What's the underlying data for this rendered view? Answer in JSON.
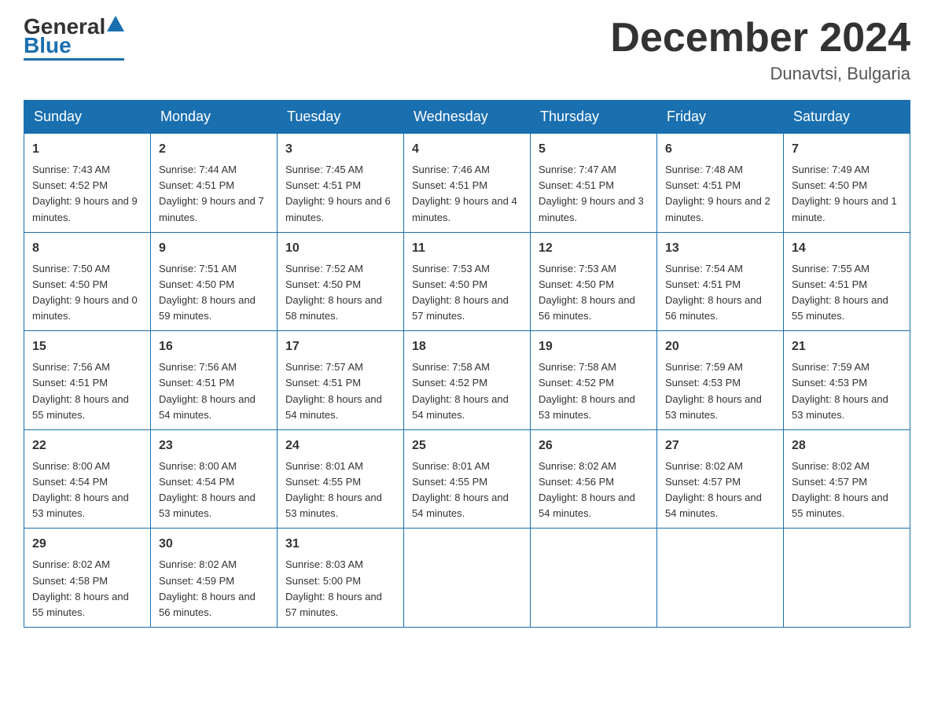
{
  "logo": {
    "general": "General",
    "blue": "Blue"
  },
  "header": {
    "title": "December 2024",
    "location": "Dunavtsi, Bulgaria"
  },
  "days_of_week": [
    "Sunday",
    "Monday",
    "Tuesday",
    "Wednesday",
    "Thursday",
    "Friday",
    "Saturday"
  ],
  "weeks": [
    [
      {
        "day": "1",
        "sunrise": "7:43 AM",
        "sunset": "4:52 PM",
        "daylight": "9 hours and 9 minutes."
      },
      {
        "day": "2",
        "sunrise": "7:44 AM",
        "sunset": "4:51 PM",
        "daylight": "9 hours and 7 minutes."
      },
      {
        "day": "3",
        "sunrise": "7:45 AM",
        "sunset": "4:51 PM",
        "daylight": "9 hours and 6 minutes."
      },
      {
        "day": "4",
        "sunrise": "7:46 AM",
        "sunset": "4:51 PM",
        "daylight": "9 hours and 4 minutes."
      },
      {
        "day": "5",
        "sunrise": "7:47 AM",
        "sunset": "4:51 PM",
        "daylight": "9 hours and 3 minutes."
      },
      {
        "day": "6",
        "sunrise": "7:48 AM",
        "sunset": "4:51 PM",
        "daylight": "9 hours and 2 minutes."
      },
      {
        "day": "7",
        "sunrise": "7:49 AM",
        "sunset": "4:50 PM",
        "daylight": "9 hours and 1 minute."
      }
    ],
    [
      {
        "day": "8",
        "sunrise": "7:50 AM",
        "sunset": "4:50 PM",
        "daylight": "9 hours and 0 minutes."
      },
      {
        "day": "9",
        "sunrise": "7:51 AM",
        "sunset": "4:50 PM",
        "daylight": "8 hours and 59 minutes."
      },
      {
        "day": "10",
        "sunrise": "7:52 AM",
        "sunset": "4:50 PM",
        "daylight": "8 hours and 58 minutes."
      },
      {
        "day": "11",
        "sunrise": "7:53 AM",
        "sunset": "4:50 PM",
        "daylight": "8 hours and 57 minutes."
      },
      {
        "day": "12",
        "sunrise": "7:53 AM",
        "sunset": "4:50 PM",
        "daylight": "8 hours and 56 minutes."
      },
      {
        "day": "13",
        "sunrise": "7:54 AM",
        "sunset": "4:51 PM",
        "daylight": "8 hours and 56 minutes."
      },
      {
        "day": "14",
        "sunrise": "7:55 AM",
        "sunset": "4:51 PM",
        "daylight": "8 hours and 55 minutes."
      }
    ],
    [
      {
        "day": "15",
        "sunrise": "7:56 AM",
        "sunset": "4:51 PM",
        "daylight": "8 hours and 55 minutes."
      },
      {
        "day": "16",
        "sunrise": "7:56 AM",
        "sunset": "4:51 PM",
        "daylight": "8 hours and 54 minutes."
      },
      {
        "day": "17",
        "sunrise": "7:57 AM",
        "sunset": "4:51 PM",
        "daylight": "8 hours and 54 minutes."
      },
      {
        "day": "18",
        "sunrise": "7:58 AM",
        "sunset": "4:52 PM",
        "daylight": "8 hours and 54 minutes."
      },
      {
        "day": "19",
        "sunrise": "7:58 AM",
        "sunset": "4:52 PM",
        "daylight": "8 hours and 53 minutes."
      },
      {
        "day": "20",
        "sunrise": "7:59 AM",
        "sunset": "4:53 PM",
        "daylight": "8 hours and 53 minutes."
      },
      {
        "day": "21",
        "sunrise": "7:59 AM",
        "sunset": "4:53 PM",
        "daylight": "8 hours and 53 minutes."
      }
    ],
    [
      {
        "day": "22",
        "sunrise": "8:00 AM",
        "sunset": "4:54 PM",
        "daylight": "8 hours and 53 minutes."
      },
      {
        "day": "23",
        "sunrise": "8:00 AM",
        "sunset": "4:54 PM",
        "daylight": "8 hours and 53 minutes."
      },
      {
        "day": "24",
        "sunrise": "8:01 AM",
        "sunset": "4:55 PM",
        "daylight": "8 hours and 53 minutes."
      },
      {
        "day": "25",
        "sunrise": "8:01 AM",
        "sunset": "4:55 PM",
        "daylight": "8 hours and 54 minutes."
      },
      {
        "day": "26",
        "sunrise": "8:02 AM",
        "sunset": "4:56 PM",
        "daylight": "8 hours and 54 minutes."
      },
      {
        "day": "27",
        "sunrise": "8:02 AM",
        "sunset": "4:57 PM",
        "daylight": "8 hours and 54 minutes."
      },
      {
        "day": "28",
        "sunrise": "8:02 AM",
        "sunset": "4:57 PM",
        "daylight": "8 hours and 55 minutes."
      }
    ],
    [
      {
        "day": "29",
        "sunrise": "8:02 AM",
        "sunset": "4:58 PM",
        "daylight": "8 hours and 55 minutes."
      },
      {
        "day": "30",
        "sunrise": "8:02 AM",
        "sunset": "4:59 PM",
        "daylight": "8 hours and 56 minutes."
      },
      {
        "day": "31",
        "sunrise": "8:03 AM",
        "sunset": "5:00 PM",
        "daylight": "8 hours and 57 minutes."
      },
      null,
      null,
      null,
      null
    ]
  ]
}
